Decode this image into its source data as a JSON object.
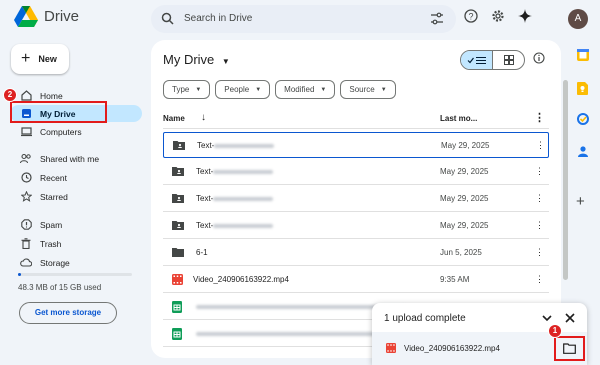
{
  "app": {
    "name": "Drive"
  },
  "search": {
    "placeholder": "Search in Drive"
  },
  "user": {
    "avatar_letter": "A"
  },
  "sidebar": {
    "new_label": "New",
    "items": [
      {
        "label": "Home",
        "icon": "home-icon"
      },
      {
        "label": "My Drive",
        "icon": "drive-icon",
        "active": true
      },
      {
        "label": "Computers",
        "icon": "computer-icon"
      },
      {
        "label": "Shared with me",
        "icon": "people-icon"
      },
      {
        "label": "Recent",
        "icon": "clock-icon"
      },
      {
        "label": "Starred",
        "icon": "star-icon"
      },
      {
        "label": "Spam",
        "icon": "spam-icon"
      },
      {
        "label": "Trash",
        "icon": "trash-icon"
      },
      {
        "label": "Storage",
        "icon": "cloud-icon"
      }
    ],
    "storage_text": "48.3 MB of 15 GB used",
    "storage_used_fraction": 0.03,
    "get_more_label": "Get more storage"
  },
  "main": {
    "title": "My Drive",
    "filters": [
      "Type",
      "People",
      "Modified",
      "Source"
    ],
    "columns": {
      "name": "Name",
      "last_modified": "Last mo..."
    },
    "rows": [
      {
        "name": "Text-",
        "date": "May 29, 2025",
        "icon": "shared-folder-icon",
        "blurred": true,
        "selected": true
      },
      {
        "name": "Text-",
        "date": "May 29, 2025",
        "icon": "shared-folder-icon",
        "blurred": true
      },
      {
        "name": "Text-",
        "date": "May 29, 2025",
        "icon": "shared-folder-icon",
        "blurred": true
      },
      {
        "name": "Text-",
        "date": "May 29, 2025",
        "icon": "shared-folder-icon",
        "blurred": true
      },
      {
        "name": "6-1",
        "date": "Jun 5, 2025",
        "icon": "folder-icon"
      },
      {
        "name": "Video_240906163922.mp4",
        "date": "9:35 AM",
        "icon": "video-icon"
      },
      {
        "name": "",
        "date": "",
        "icon": "sheets-icon",
        "blurred": true
      },
      {
        "name": "",
        "date": "",
        "icon": "sheets-icon",
        "blurred": true
      }
    ]
  },
  "upload": {
    "title": "1 upload complete",
    "file_name": "Video_240906163922.mp4"
  },
  "annotations": {
    "step1": "1",
    "step2": "2"
  },
  "colors": {
    "accent": "#0b57d0",
    "active_bg": "#c2e7ff",
    "annotation_red": "#e21b1b"
  }
}
